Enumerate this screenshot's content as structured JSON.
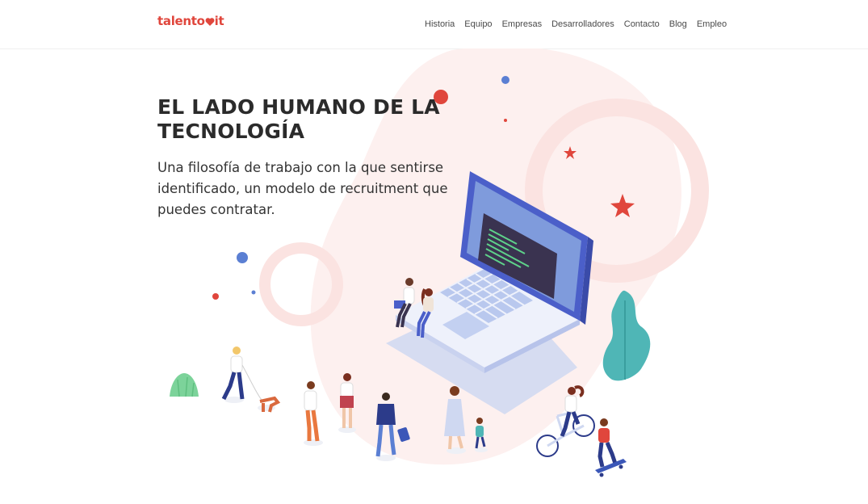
{
  "brand": {
    "logo_text_left": "talento",
    "logo_text_right": "it",
    "accent": "#e0463c"
  },
  "nav": {
    "items": [
      "Historia",
      "Equipo",
      "Empresas",
      "Desarrolladores",
      "Contacto",
      "Blog",
      "Empleo"
    ]
  },
  "hero": {
    "title": "EL LADO HUMANO DE LA TECNOLOGÍA",
    "subtitle": "Una filosofía de trabajo con la que sentirse identificado, un modelo de recruitment que puedes contratar."
  },
  "colors": {
    "blob": "#fdeeee",
    "laptop_blue": "#4b5fc9",
    "screen": "#7f9bdc",
    "code_bg": "#3a3350",
    "code_green": "#5ed28a",
    "plant_teal": "#4fb6b6",
    "grass_green": "#7cd39a",
    "dot_blue": "#5b7fd3",
    "dot_red": "#e0463c"
  }
}
